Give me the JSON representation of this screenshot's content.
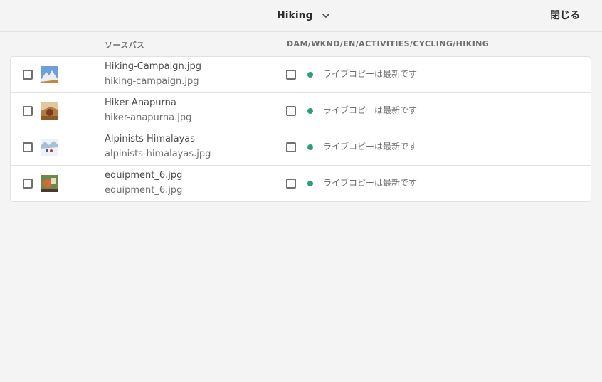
{
  "header": {
    "title": "Hiking",
    "close_label": "閉じる"
  },
  "columns": {
    "source": "ソースパス",
    "destination": "DAM/WKND/EN/ACTIVITIES/CYCLING/HIKING"
  },
  "colors": {
    "status_dot": "#2d9d78",
    "background": "#f4f4f4"
  },
  "rows": [
    {
      "title": "Hiking-Campaign.jpg",
      "filename": "hiking-campaign.jpg",
      "status": "ライブコピーは最新です"
    },
    {
      "title": "Hiker Anapurna",
      "filename": "hiker-anapurna.jpg",
      "status": "ライブコピーは最新です"
    },
    {
      "title": "Alpinists Himalayas",
      "filename": "alpinists-himalayas.jpg",
      "status": "ライブコピーは最新です"
    },
    {
      "title": "equipment_6.jpg",
      "filename": "equipment_6.jpg",
      "status": "ライブコピーは最新です"
    }
  ]
}
